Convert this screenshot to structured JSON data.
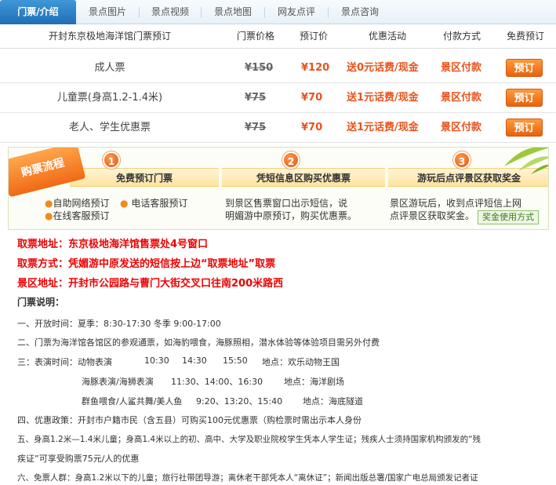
{
  "tabs": [
    "门票/介绍",
    "景点图片",
    "景点视频",
    "景点地图",
    "网友点评",
    "景点咨询"
  ],
  "table": {
    "headers": {
      "name": "开封东京极地海洋馆门票预订",
      "orig": "门票价格",
      "price": "预订价",
      "promo": "优惠活动",
      "pay": "付款方式",
      "book": "免费预订"
    },
    "rows": [
      {
        "name": "成人票",
        "orig": "¥150",
        "price": "¥120",
        "promo": "送0元话费/现金",
        "pay": "景区付款",
        "book": "预订"
      },
      {
        "name": "儿童票(身高1.2-1.4米)",
        "orig": "¥75",
        "price": "¥70",
        "promo": "送1元话费/现金",
        "pay": "景区付款",
        "book": "预订"
      },
      {
        "name": "老人、学生优惠票",
        "orig": "¥75",
        "price": "¥70",
        "promo": "送1元话费/现金",
        "pay": "景区付款",
        "book": "预订"
      }
    ]
  },
  "process": {
    "badge": "购票流程",
    "steps": [
      {
        "num": "1",
        "title": "免费预订门票"
      },
      {
        "num": "2",
        "title": "凭短信息区购买优惠票"
      },
      {
        "num": "3",
        "title": "游玩后点评景区获取奖金"
      }
    ],
    "step1": {
      "a": "自助网络预订",
      "b": "电话客服预订",
      "c": "在线客服预订"
    },
    "step2": {
      "l1": "到景区售票窗口出示短信，说",
      "l2": "明媚游中原预订，购买优惠票。"
    },
    "step3": {
      "l1": "景区游玩后，收到点评短信上网",
      "l2": "点评景区获取奖金。",
      "link": "奖金使用方式"
    }
  },
  "info": {
    "address": "取票地址：东京极地海洋馆售票处4号窗口",
    "method": "取票方式：凭媚游中原发送的短信按上边“取票地址”取票",
    "scenic": "景区地址：开封市公园路与曹门大街交叉口往南200米路西"
  },
  "notice": {
    "title": "门票说明：",
    "l1": "一、开放时间：夏季：8:30-17:30 冬季  9:00-17:00",
    "l2": "二、门票为海洋馆各馆区的参观通票，如海豹喂食，海豚照相，潜水体验等体验项目需另外付费",
    "l3a": "三：表演时间：动物表演",
    "l3b": "10:30",
    "l3c": "14:30",
    "l3d": "15:50",
    "l3e": "地点：欢乐动物王国",
    "l4a": "海豚表演/海狮表演",
    "l4b": "11:30、14:00、16:30",
    "l4c": "地点：海洋剧场",
    "l5a": "群鱼喂食/人鲨共舞/美人鱼",
    "l5b": "9:20、13:20、15:40",
    "l5c": "地点：海底隧道",
    "l6": "四、优惠政策：开封市户籍市民（含五县）可购买100元优惠票（购检票时需出示本人身份",
    "l7": "五、身高1.2米—1.4米儿童；身高1.4米以上的初、高中、大学及职业院校学生凭本人学生证；残疾人士须持国家机构颁发的“残",
    "l8": "疾证”可享受购票75元/人的优惠",
    "l9": "六、免票人群：身高1.2米以下的儿童；旅行社带团导游；离休老干部凭本人“离休证”；新闻出版总署/国家广电总局颁发记者证"
  }
}
